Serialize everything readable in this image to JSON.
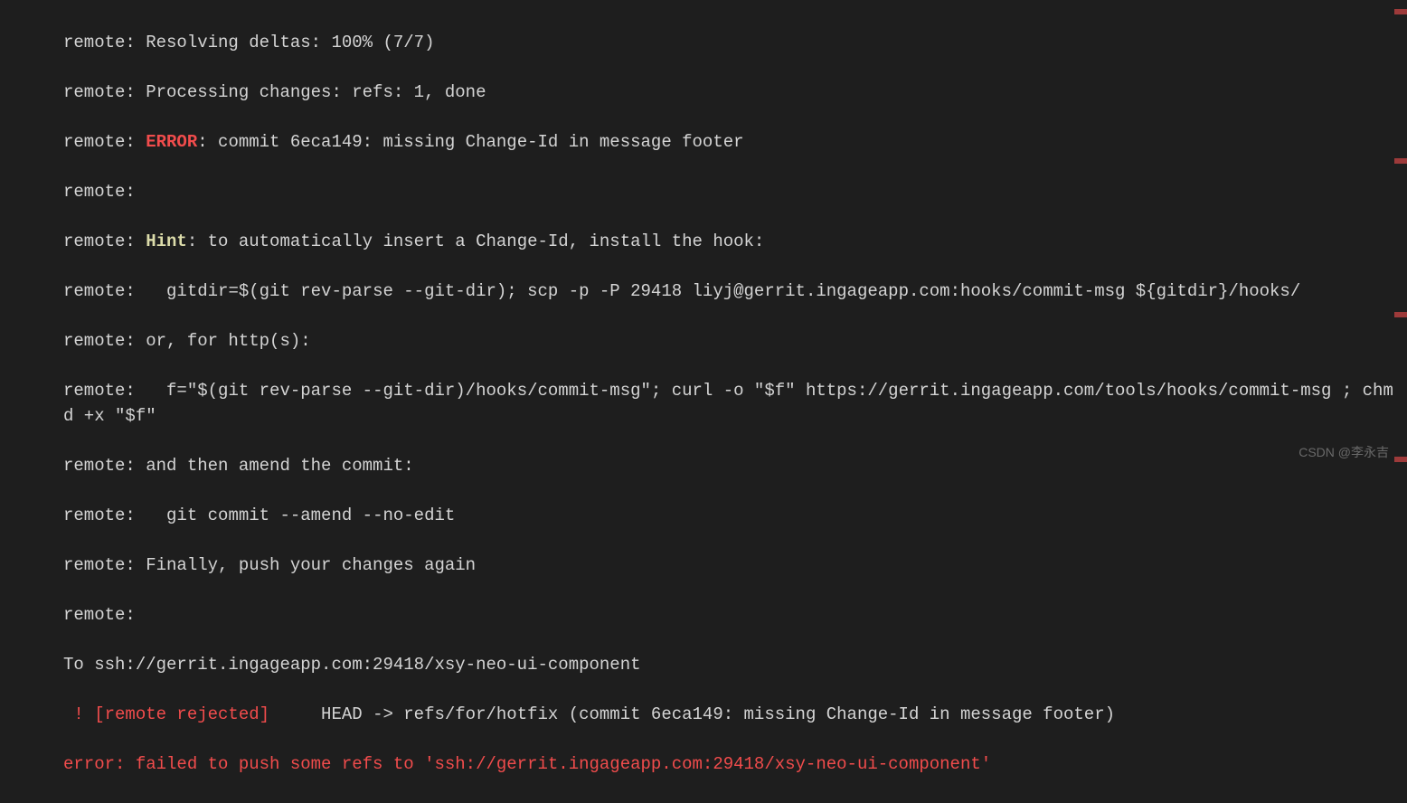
{
  "terminal": {
    "lines": {
      "l1_prefix": "remote: ",
      "l1_text": "Resolving deltas: 100% (7/7)",
      "l2_prefix": "remote: ",
      "l2_text": "Processing changes: refs: 1, done",
      "l3_prefix": "remote: ",
      "l3_error": "ERROR",
      "l3_text": ": commit 6eca149: missing Change-Id in message footer",
      "l4_prefix": "remote:",
      "l5_prefix": "remote: ",
      "l5_hint": "Hint",
      "l5_text": ": to automatically insert a Change-Id, install the hook:",
      "l6_prefix": "remote:   ",
      "l6_text": "gitdir=$(git rev-parse --git-dir); scp -p -P 29418 liyj@gerrit.ingageapp.com:hooks/commit-msg ${gitdir}/hooks/",
      "l7_prefix": "remote: ",
      "l7_text": "or, for http(s):",
      "l8_prefix": "remote:   ",
      "l8_text": "f=\"$(git rev-parse --git-dir)/hooks/commit-msg\"; curl -o \"$f\" https://gerrit.ingageapp.com/tools/hooks/commit-msg ; chmod +x \"$f\"",
      "l9_prefix": "remote: ",
      "l9_text": "and then amend the commit:",
      "l10_prefix": "remote:   ",
      "l10_text": "git commit --amend --no-edit",
      "l11_prefix": "remote: ",
      "l11_text": "Finally, push your changes again",
      "l12_prefix": "remote:",
      "l13_text": "To ssh://gerrit.ingageapp.com:29418/xsy-neo-ui-component",
      "l14_rejected": " ! [remote rejected]",
      "l14_text": "     HEAD -> refs/for/hotfix (commit 6eca149: missing Change-Id in message footer)",
      "l15_text": "error: failed to push some refs to 'ssh://gerrit.ingageapp.com:29418/xsy-neo-ui-component'"
    }
  },
  "watermark": "CSDN @李永吉"
}
